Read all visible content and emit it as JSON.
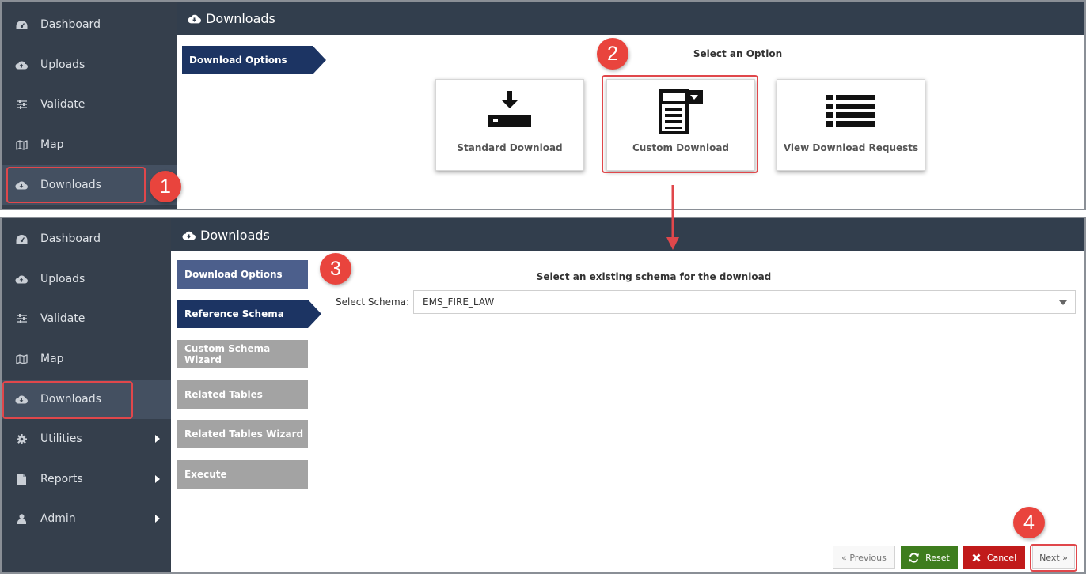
{
  "top_panel": {
    "sidebar": [
      {
        "label": "Dashboard",
        "icon": "dashboard-icon"
      },
      {
        "label": "Uploads",
        "icon": "cloud-upload-icon"
      },
      {
        "label": "Validate",
        "icon": "sliders-icon"
      },
      {
        "label": "Map",
        "icon": "map-icon"
      },
      {
        "label": "Downloads",
        "icon": "cloud-download-icon"
      }
    ],
    "header": {
      "title": "Downloads",
      "icon": "cloud-download-icon"
    },
    "step": "Download Options",
    "heading": "Select an Option",
    "cards": [
      {
        "label": "Standard Download",
        "icon": "download-tray-icon"
      },
      {
        "label": "Custom Download",
        "icon": "custom-form-icon"
      },
      {
        "label": "View Download Requests",
        "icon": "list-icon"
      }
    ]
  },
  "bottom_panel": {
    "sidebar": [
      {
        "label": "Dashboard",
        "icon": "dashboard-icon"
      },
      {
        "label": "Uploads",
        "icon": "cloud-upload-icon"
      },
      {
        "label": "Validate",
        "icon": "sliders-icon"
      },
      {
        "label": "Map",
        "icon": "map-icon"
      },
      {
        "label": "Downloads",
        "icon": "cloud-download-icon"
      },
      {
        "label": "Utilities",
        "icon": "gear-icon"
      },
      {
        "label": "Reports",
        "icon": "document-icon"
      },
      {
        "label": "Admin",
        "icon": "user-icon"
      }
    ],
    "header": {
      "title": "Downloads",
      "icon": "cloud-download-icon"
    },
    "steps": [
      "Download Options",
      "Reference Schema",
      "Custom Schema Wizard",
      "Related Tables",
      "Related Tables Wizard",
      "Execute"
    ],
    "heading": "Select an existing schema for the download",
    "schema_label": "Select Schema:",
    "schema_value": "EMS_FIRE_LAW",
    "buttons": {
      "previous": "« Previous",
      "reset": "Reset",
      "cancel": "Cancel",
      "next": "Next »"
    }
  },
  "badges": [
    "1",
    "2",
    "3",
    "4"
  ],
  "colors": {
    "sidebar_bg": "#353f4c",
    "header_bg": "#323e4d",
    "step_active": "#1c3463",
    "step_visited": "#4c5f8c",
    "step_disabled": "#a3a3a3",
    "highlight": "#e0474b",
    "badge": "#e9443d",
    "reset_button": "#3e7d1e",
    "cancel_button": "#c11a1a"
  }
}
